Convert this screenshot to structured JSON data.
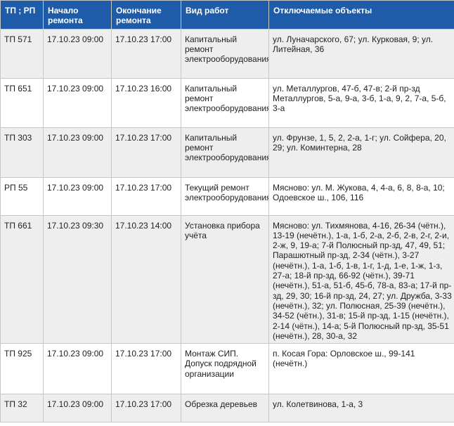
{
  "table": {
    "headers": [
      "ТП ; РП",
      "Начало ремонта",
      "Окончание ремонта",
      "Вид работ",
      "Отключаемые объекты"
    ],
    "rows": [
      [
        "ТП 571",
        "17.10.23 09:00",
        "17.10.23 17:00",
        "Капитальный ремонт электрооборудования",
        "ул. Луначарского, 67; ул. Курковая, 9; ул. Литейная, 36"
      ],
      [
        "ТП 651",
        "17.10.23 09:00",
        "17.10.23 16:00",
        "Капитальный ремонт электрооборудования",
        "ул. Металлургов, 47-б, 47-в; 2-й пр-зд Металлургов, 5-а, 9-а, 3-б, 1-а, 9, 2, 7-а, 5-б, 3-а"
      ],
      [
        "ТП 303",
        "17.10.23 09:00",
        "17.10.23 17:00",
        "Капитальный ремонт электрооборудования",
        "ул. Фрунзе, 1, 5, 2, 2-а, 1-г; ул. Сойфера, 20, 29; ул. Коминтерна, 28"
      ],
      [
        "РП 55",
        "17.10.23 09:00",
        "17.10.23 17:00",
        "Текущий ремонт электрооборудования",
        "Мясново: ул. М. Жукова, 4, 4-а, 6, 8, 8-а, 10; Одоевское ш., 106, 116"
      ],
      [
        "ТП 661",
        "17.10.23 09:30",
        "17.10.23 14:00",
        "Установка прибора учёта",
        "Мясново: ул. Тихмянова, 4-16, 26-34 (чётн.), 13-19 (нечётн.), 1-а, 1-б, 2-а, 2-б, 2-в, 2-г, 2-и, 2-ж, 9, 19-а; 7-й Полюсный пр-зд, 47, 49, 51; Парашютный пр-зд, 2-34 (чётн.), 3-27 (нечётн.), 1-а, 1-б, 1-в, 1-г, 1-д, 1-е, 1-ж, 1-з, 27-а; 18-й пр-зд, 66-92 (чётн.), 39-71 (нечётн.), 51-а, 51-б, 45-б, 78-а, 83-а; 17-й пр-зд, 29, 30; 16-й пр-зд, 24, 27; ул. Дружба, 3-33 (нечётн.), 32; ул. Полюсная, 25-39 (нечётн.), 34-52 (чётн.), 31-в; 15-й пр-зд, 1-15 (нечётн.), 2-14 (чётн.), 14-а; 5-й Полюсный пр-зд, 35-51 (нечётн.), 28, 30-а, 32"
      ],
      [
        "ТП 925",
        "17.10.23 09:00",
        "17.10.23 17:00",
        "Монтаж СИП. Допуск подрядной организации",
        "п. Косая Гора: Орловское ш., 99-141 (нечётн.)"
      ],
      [
        "ТП 32",
        "17.10.23 09:00",
        "17.10.23 17:00",
        "Обрезка деревьев",
        "ул. Колетвинова, 1-а, 3"
      ]
    ]
  }
}
